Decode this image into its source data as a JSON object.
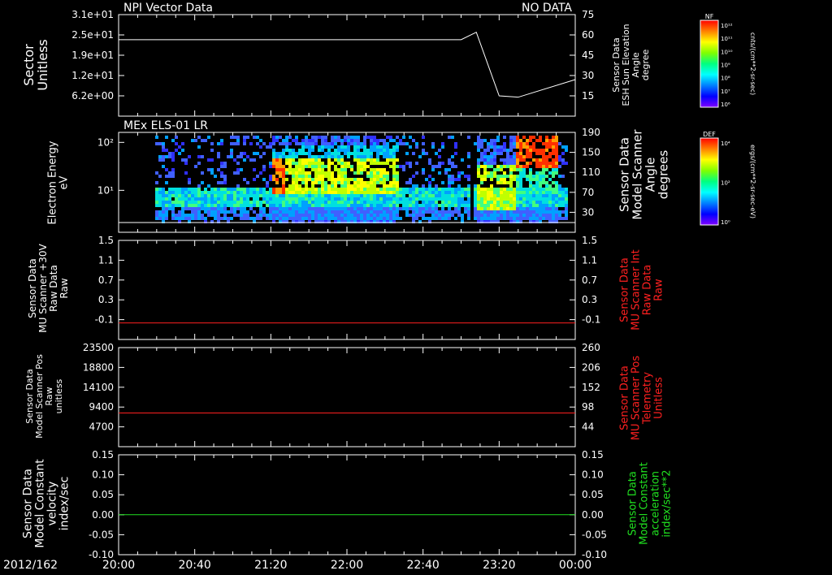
{
  "panel1": {
    "title": "NPI Vector Data",
    "status": "NO DATA",
    "left_label": [
      "Sector",
      "Unitless"
    ],
    "right_label": [
      "Sensor Data",
      "ESH Sun Elevation",
      "Angle",
      "degree"
    ]
  },
  "panel2": {
    "title": "MEx ELS-01 LR",
    "left_label": [
      "Electron Energy",
      "eV"
    ],
    "right_label": [
      "Sensor Data",
      "Model Scanner",
      "Angle",
      "degrees"
    ]
  },
  "panel3": {
    "left_label": [
      "Sensor Data",
      "MU Scanner +30V",
      "Raw Data",
      "Raw"
    ],
    "right_label": [
      "Sensor Data",
      "MU Scanner Int",
      "Raw Data",
      "Raw"
    ]
  },
  "panel4": {
    "left_label": [
      "Sensor Data",
      "Model Scanner Pos",
      "Raw",
      "unitless"
    ],
    "right_label": [
      "Sensor Data",
      "MU Scanner Pos",
      "Telemetry",
      "Unitless"
    ]
  },
  "panel5": {
    "left_label": [
      "Sensor Data",
      "Model Constant",
      "velocity",
      "index/sec"
    ],
    "right_label": [
      "Sensor Data",
      "Model Constant",
      "acceleration",
      "index/sec**2"
    ]
  },
  "colorbar1": {
    "title": "NF",
    "unit": "cnts/(cm**2-sr-sec)",
    "ticks": [
      "10¹²",
      "10¹¹",
      "10¹⁰",
      "10⁹",
      "10⁸",
      "10⁷",
      "10⁶"
    ]
  },
  "colorbar2": {
    "title": "DEF",
    "unit": "ergs/(cm**2-sr-sec-eV)",
    "ticks": [
      "10⁴",
      "10²",
      "10⁰"
    ]
  },
  "date_label": "2012/162",
  "colors": {
    "white": "#ffffff",
    "red": "#ff2020",
    "green": "#20e020",
    "axis": "#ffffff"
  },
  "chart_data": [
    {
      "type": "line",
      "title": "NPI Vector Data",
      "y_left_ticks": [
        "3.1e+01",
        "2.5e+01",
        "1.9e+01",
        "1.2e+01",
        "6.2e+00"
      ],
      "y_right_ticks": [
        "75",
        "60",
        "45",
        "30",
        "15"
      ],
      "ylim_right": [
        0,
        75
      ],
      "x": [
        "20:00",
        "22:30",
        "23:00",
        "23:08",
        "23:20",
        "23:30",
        "00:00"
      ],
      "series": [
        {
          "values": [
            56.5,
            56.5,
            56.5,
            62,
            15,
            14,
            27
          ]
        }
      ]
    },
    {
      "type": "heatmap",
      "title": "MEx ELS-01 LR",
      "y_left_ticks": [
        "10²",
        "10¹"
      ],
      "y_right_ticks": [
        "190",
        "150",
        "110",
        "70",
        "30"
      ],
      "ylim_right": [
        0,
        190
      ],
      "series": [
        {
          "values": [
            20,
            20
          ]
        }
      ]
    },
    {
      "type": "line",
      "y_left_ticks": [
        "1.5",
        "1.1",
        "0.7",
        "0.3",
        "-0.1"
      ],
      "y_right_ticks": [
        "1.5",
        "1.1",
        "0.7",
        "0.3",
        "-0.1"
      ],
      "ylim": [
        -0.3,
        1.5
      ],
      "series": [
        {
          "values": [
            0,
            0
          ]
        }
      ]
    },
    {
      "type": "line",
      "y_left_ticks": [
        "23500",
        "18800",
        "14100",
        "9400",
        "4700"
      ],
      "y_right_ticks": [
        "260",
        "206",
        "152",
        "98",
        "44"
      ],
      "ylim": [
        0,
        23500
      ],
      "series": [
        {
          "values": [
            8000,
            8000
          ]
        }
      ]
    },
    {
      "type": "line",
      "y_left_ticks": [
        "0.15",
        "0.10",
        "0.05",
        "0.00",
        "-0.05",
        "-0.10"
      ],
      "y_right_ticks": [
        "0.15",
        "0.10",
        "0.05",
        "0.00",
        "-0.05",
        "-0.10"
      ],
      "ylim": [
        -0.1,
        0.15
      ],
      "series": [
        {
          "values": [
            0,
            0
          ]
        }
      ]
    }
  ],
  "x_ticks": [
    "20:00",
    "20:40",
    "21:20",
    "22:00",
    "22:40",
    "23:20",
    "00:00"
  ]
}
